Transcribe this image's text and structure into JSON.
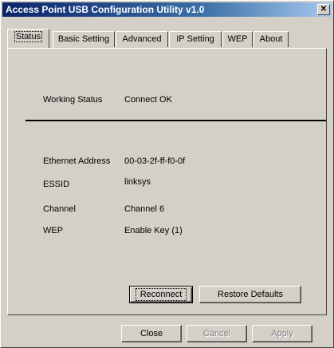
{
  "window": {
    "title": "Access Point USB Configuration Utility v1.0",
    "close_glyph": "✕"
  },
  "tabs": [
    {
      "label": "Status",
      "active": true
    },
    {
      "label": "Basic Setting",
      "active": false
    },
    {
      "label": "Advanced",
      "active": false
    },
    {
      "label": "IP Setting",
      "active": false
    },
    {
      "label": "WEP",
      "active": false
    },
    {
      "label": "About",
      "active": false
    }
  ],
  "status": {
    "working_status_label": "Working Status",
    "working_status_value": "Connect OK",
    "ethernet_label": "Ethernet Address",
    "ethernet_value": "00-03-2f-ff-f0-0f",
    "essid_label": "ESSID",
    "essid_value": "linksys",
    "channel_label": "Channel",
    "channel_value": "Channel 6",
    "wep_label": "WEP",
    "wep_value": "Enable Key (1)"
  },
  "panel_buttons": {
    "reconnect": "Reconnect",
    "restore_defaults": "Restore Defaults"
  },
  "dialog_buttons": {
    "close": "Close",
    "cancel": "Cancel",
    "apply": "Apply"
  },
  "colors": {
    "titlebar_start": "#0a246a",
    "titlebar_end": "#a6caf0",
    "face": "#d4d0c8"
  }
}
